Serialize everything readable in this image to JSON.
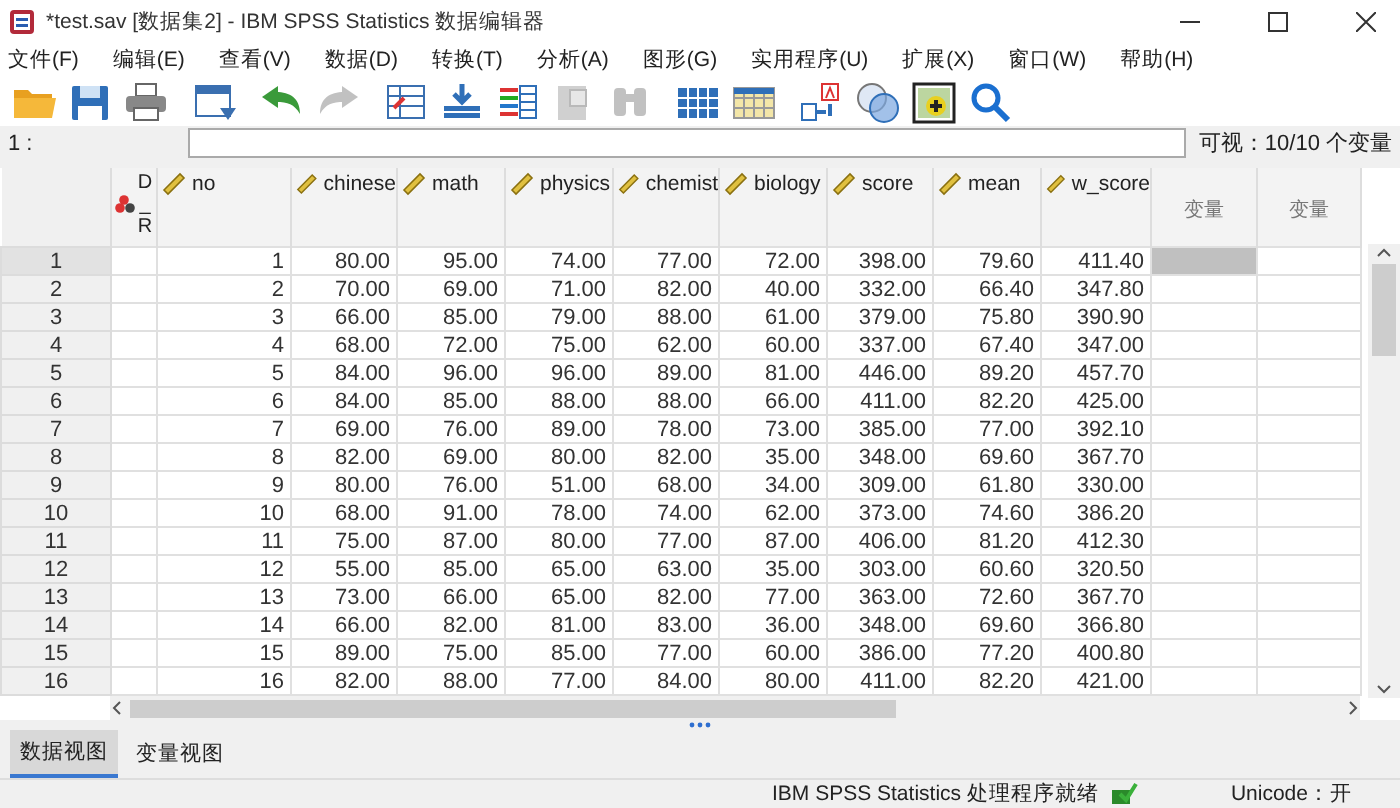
{
  "window": {
    "title": "*test.sav [数据集2] - IBM SPSS Statistics 数据编辑器"
  },
  "menu": [
    "文件(F)",
    "编辑(E)",
    "查看(V)",
    "数据(D)",
    "转换(T)",
    "分析(A)",
    "图形(G)",
    "实用程序(U)",
    "扩展(X)",
    "窗口(W)",
    "帮助(H)"
  ],
  "toolbar": [
    {
      "kind": "open",
      "disabled": false
    },
    {
      "kind": "save",
      "disabled": false
    },
    {
      "kind": "print",
      "disabled": false
    },
    {
      "kind": "dialog",
      "disabled": false
    },
    {
      "kind": "undo",
      "disabled": false
    },
    {
      "kind": "redo",
      "disabled": true
    },
    {
      "kind": "goto-case",
      "disabled": false
    },
    {
      "kind": "goto-variable",
      "disabled": false
    },
    {
      "kind": "variables",
      "disabled": false
    },
    {
      "kind": "document",
      "disabled": true
    },
    {
      "kind": "find",
      "disabled": true
    },
    {
      "kind": "split",
      "disabled": false
    },
    {
      "kind": "weight",
      "disabled": false
    },
    {
      "kind": "value-labels",
      "disabled": false
    },
    {
      "kind": "sets",
      "disabled": false
    },
    {
      "kind": "insert",
      "disabled": false
    },
    {
      "kind": "search",
      "disabled": false
    }
  ],
  "cell_editor": {
    "cell_ref": "1 :",
    "visible": "可视：10/10 个变量"
  },
  "columns": [
    {
      "name": "D_R",
      "kind": "nominal"
    },
    {
      "name": "no",
      "kind": "scale"
    },
    {
      "name": "chinese",
      "kind": "scale"
    },
    {
      "name": "math",
      "kind": "scale"
    },
    {
      "name": "physics",
      "kind": "scale"
    },
    {
      "name": "chemist",
      "kind": "scale"
    },
    {
      "name": "biology",
      "kind": "scale"
    },
    {
      "name": "score",
      "kind": "scale"
    },
    {
      "name": "mean",
      "kind": "scale"
    },
    {
      "name": "w_score",
      "kind": "scale"
    },
    {
      "name": "变量",
      "kind": "empty"
    },
    {
      "name": "变量",
      "kind": "empty"
    }
  ],
  "rows": [
    {
      "num": "1",
      "selected": true,
      "cells": [
        "1",
        "80.00",
        "95.00",
        "74.00",
        "77.00",
        "72.00",
        "398.00",
        "79.60",
        "411.40"
      ]
    },
    {
      "num": "2",
      "selected": false,
      "cells": [
        "2",
        "70.00",
        "69.00",
        "71.00",
        "82.00",
        "40.00",
        "332.00",
        "66.40",
        "347.80"
      ]
    },
    {
      "num": "3",
      "selected": false,
      "cells": [
        "3",
        "66.00",
        "85.00",
        "79.00",
        "88.00",
        "61.00",
        "379.00",
        "75.80",
        "390.90"
      ]
    },
    {
      "num": "4",
      "selected": false,
      "cells": [
        "4",
        "68.00",
        "72.00",
        "75.00",
        "62.00",
        "60.00",
        "337.00",
        "67.40",
        "347.00"
      ]
    },
    {
      "num": "5",
      "selected": false,
      "cells": [
        "5",
        "84.00",
        "96.00",
        "96.00",
        "89.00",
        "81.00",
        "446.00",
        "89.20",
        "457.70"
      ]
    },
    {
      "num": "6",
      "selected": false,
      "cells": [
        "6",
        "84.00",
        "85.00",
        "88.00",
        "88.00",
        "66.00",
        "411.00",
        "82.20",
        "425.00"
      ]
    },
    {
      "num": "7",
      "selected": false,
      "cells": [
        "7",
        "69.00",
        "76.00",
        "89.00",
        "78.00",
        "73.00",
        "385.00",
        "77.00",
        "392.10"
      ]
    },
    {
      "num": "8",
      "selected": false,
      "cells": [
        "8",
        "82.00",
        "69.00",
        "80.00",
        "82.00",
        "35.00",
        "348.00",
        "69.60",
        "367.70"
      ]
    },
    {
      "num": "9",
      "selected": false,
      "cells": [
        "9",
        "80.00",
        "76.00",
        "51.00",
        "68.00",
        "34.00",
        "309.00",
        "61.80",
        "330.00"
      ]
    },
    {
      "num": "10",
      "selected": false,
      "cells": [
        "10",
        "68.00",
        "91.00",
        "78.00",
        "74.00",
        "62.00",
        "373.00",
        "74.60",
        "386.20"
      ]
    },
    {
      "num": "11",
      "selected": false,
      "cells": [
        "11",
        "75.00",
        "87.00",
        "80.00",
        "77.00",
        "87.00",
        "406.00",
        "81.20",
        "412.30"
      ]
    },
    {
      "num": "12",
      "selected": false,
      "cells": [
        "12",
        "55.00",
        "85.00",
        "65.00",
        "63.00",
        "35.00",
        "303.00",
        "60.60",
        "320.50"
      ]
    },
    {
      "num": "13",
      "selected": false,
      "cells": [
        "13",
        "73.00",
        "66.00",
        "65.00",
        "82.00",
        "77.00",
        "363.00",
        "72.60",
        "367.70"
      ]
    },
    {
      "num": "14",
      "selected": false,
      "cells": [
        "14",
        "66.00",
        "82.00",
        "81.00",
        "83.00",
        "36.00",
        "348.00",
        "69.60",
        "366.80"
      ]
    },
    {
      "num": "15",
      "selected": false,
      "cells": [
        "15",
        "89.00",
        "75.00",
        "85.00",
        "77.00",
        "60.00",
        "386.00",
        "77.20",
        "400.80"
      ]
    },
    {
      "num": "16",
      "selected": false,
      "cells": [
        "16",
        "82.00",
        "88.00",
        "77.00",
        "84.00",
        "80.00",
        "411.00",
        "82.20",
        "421.00"
      ]
    }
  ],
  "view_tabs": [
    {
      "label": "数据视图",
      "selected": true
    },
    {
      "label": "变量视图",
      "selected": false
    }
  ],
  "status_bar": {
    "processor": "IBM SPSS Statistics 处理程序就绪",
    "unicode": "Unicode：开"
  }
}
